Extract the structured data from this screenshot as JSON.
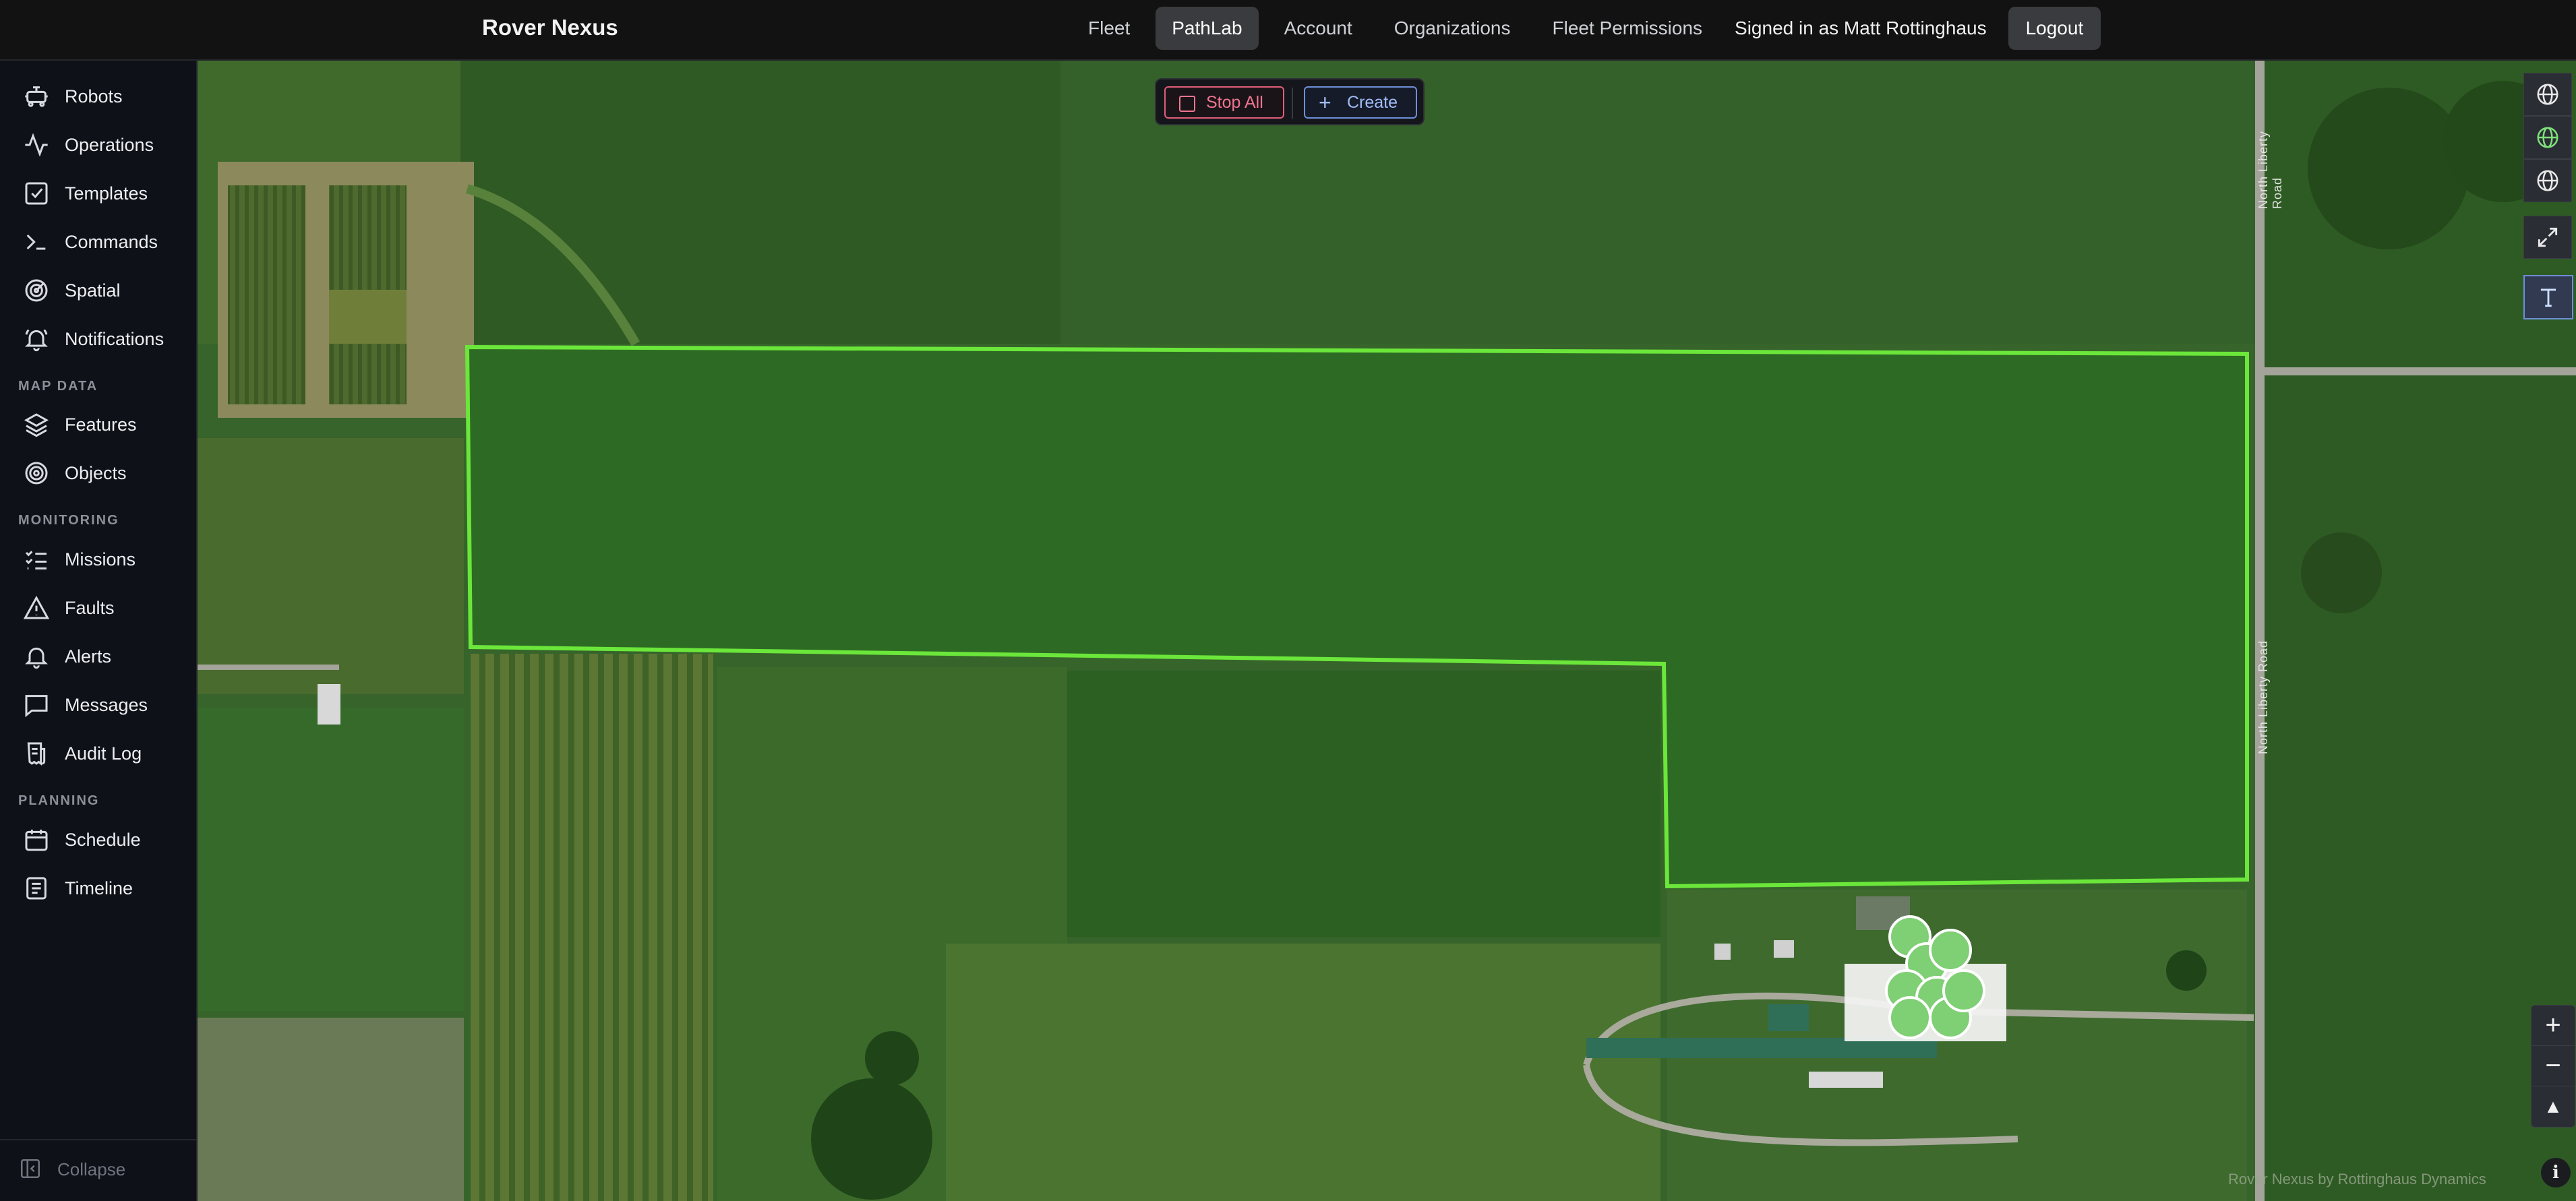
{
  "app": {
    "title": "Rover Nexus"
  },
  "nav": {
    "links": [
      {
        "label": "Fleet",
        "active": false
      },
      {
        "label": "PathLab",
        "active": true
      },
      {
        "label": "Account",
        "active": false
      },
      {
        "label": "Organizations",
        "active": false
      },
      {
        "label": "Fleet Permissions",
        "active": false
      }
    ],
    "signed_in": "Signed in as Matt Rottinghaus",
    "logout": "Logout"
  },
  "sidebar": {
    "main_items": [
      {
        "label": "Robots",
        "icon": "robot-icon"
      },
      {
        "label": "Operations",
        "icon": "activity-icon"
      },
      {
        "label": "Templates",
        "icon": "checkbox-icon"
      },
      {
        "label": "Commands",
        "icon": "terminal-icon"
      },
      {
        "label": "Spatial",
        "icon": "radar-icon"
      },
      {
        "label": "Notifications",
        "icon": "bell-icon"
      }
    ],
    "map_data_heading": "MAP DATA",
    "map_data_items": [
      {
        "label": "Features",
        "icon": "layers-icon"
      },
      {
        "label": "Objects",
        "icon": "target-icon"
      }
    ],
    "monitoring_heading": "MONITORING",
    "monitoring_items": [
      {
        "label": "Missions",
        "icon": "list-check-icon"
      },
      {
        "label": "Faults",
        "icon": "warning-icon"
      },
      {
        "label": "Alerts",
        "icon": "bell-icon"
      },
      {
        "label": "Messages",
        "icon": "message-icon"
      },
      {
        "label": "Audit Log",
        "icon": "receipt-icon"
      }
    ],
    "planning_heading": "PLANNING",
    "planning_items": [
      {
        "label": "Schedule",
        "icon": "calendar-icon"
      },
      {
        "label": "Timeline",
        "icon": "document-icon"
      }
    ],
    "collapse": "Collapse"
  },
  "map": {
    "toolbar": {
      "stop_all": "Stop All",
      "create": "Create"
    },
    "controls": [
      "globe-icon",
      "globe-icon",
      "globe-icon",
      "expand-icon",
      "text-tool-icon"
    ],
    "zoom": {
      "in": "+",
      "out": "−",
      "north": "▲"
    },
    "attribution": "Rover Nexus by Rottinghaus Dynamics",
    "road_label": "North Liberty Road",
    "field_outline_color": "#6be63a"
  }
}
